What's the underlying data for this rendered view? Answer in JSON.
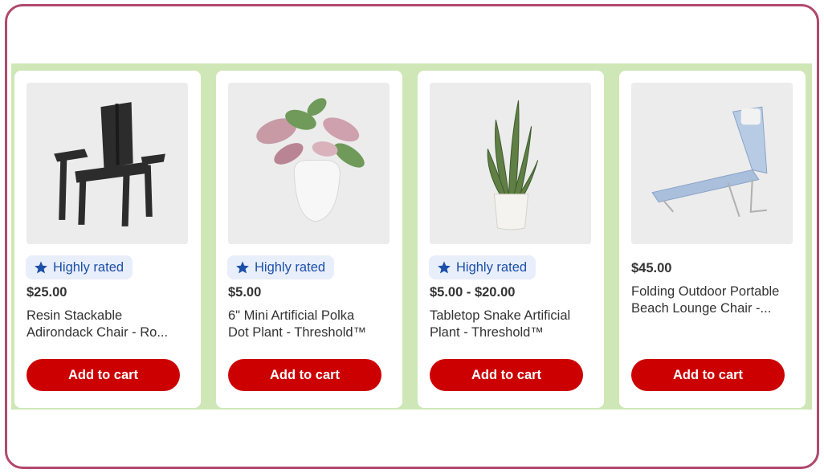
{
  "products": [
    {
      "badge": "Highly rated",
      "price": "$25.00",
      "title_line1": "Resin Stackable",
      "title_line2": "Adirondack Chair - Ro...",
      "cta": "Add to cart",
      "image_icon": "adirondack-chair-image"
    },
    {
      "badge": "Highly rated",
      "price": "$5.00",
      "title_line1": "6\" Mini Artificial Polka",
      "title_line2": "Dot Plant - Threshold™",
      "cta": "Add to cart",
      "image_icon": "polka-dot-plant-image"
    },
    {
      "badge": "Highly rated",
      "price": "$5.00 - $20.00",
      "title_line1": "Tabletop Snake Artificial",
      "title_line2": "Plant - Threshold™",
      "cta": "Add to cart",
      "image_icon": "snake-plant-image"
    },
    {
      "price": "$45.00",
      "title_line1": "Folding Outdoor Portable",
      "title_line2": "Beach Lounge Chair -...",
      "cta": "Add to cart",
      "image_icon": "lounge-chair-image"
    }
  ],
  "colors": {
    "frame_border": "#b04a6c",
    "strip_background": "#cfe7b6",
    "button": "#cc0000",
    "badge_background": "#e9eefb",
    "badge_text": "#1b4fa8"
  }
}
